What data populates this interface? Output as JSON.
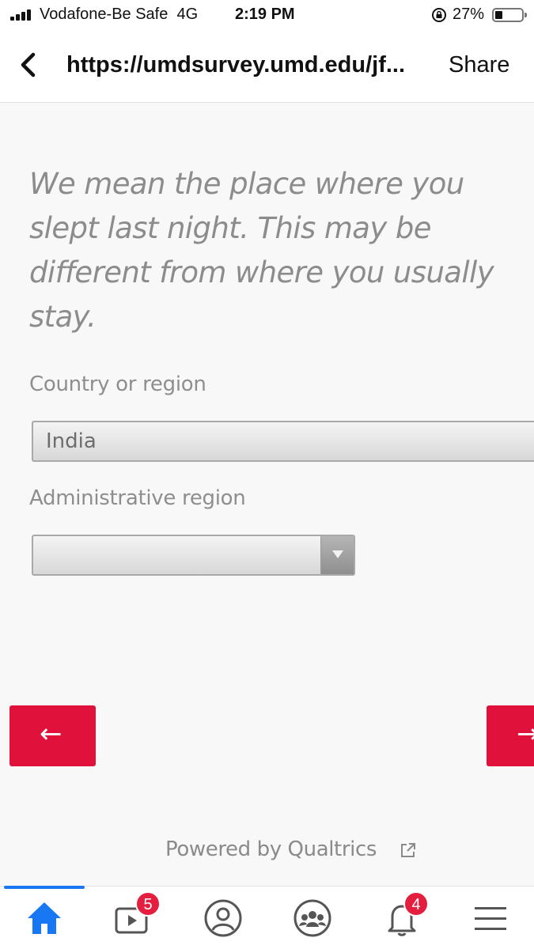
{
  "status_bar": {
    "carrier": "Vodafone-Be Safe",
    "network": "4G",
    "time": "2:19 PM",
    "battery_percent": "27%",
    "battery_level": 0.27
  },
  "browser": {
    "url": "https://umdsurvey.umd.edu/jf...",
    "share_label": "Share"
  },
  "survey": {
    "question_note": "We mean the place where you slept last night. This may be different from where you usually stay.",
    "country_label": "Country or region",
    "country_value": "India",
    "admin_label": "Administrative region",
    "admin_value": "",
    "prev_label": "←",
    "next_label": "→",
    "powered_by": "Powered by Qualtrics"
  },
  "tab_bar": {
    "watch_badge": "5",
    "notifications_badge": "4",
    "active_tab": "home",
    "accent_color": "#1877f2"
  },
  "colors": {
    "button": "#e0123b",
    "badge": "#e41e3f"
  }
}
